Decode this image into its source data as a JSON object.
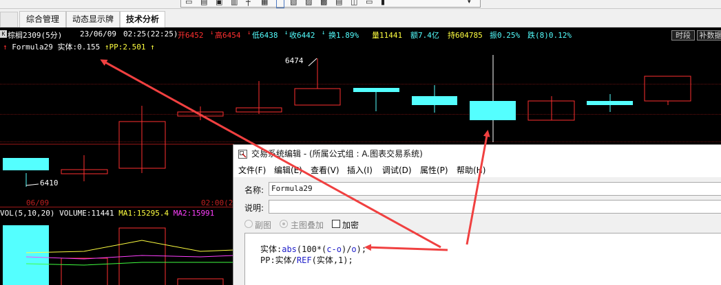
{
  "toolbar": {
    "icons": [
      "chart-icon",
      "drawing-icon",
      "layout-icon",
      "split-icon",
      "cursor-icon",
      "indicator-icon",
      "compare-icon",
      "period-icon",
      "window-icon",
      "grid-icon",
      "list-icon",
      "hand-icon",
      "pen-icon",
      "more-icon"
    ]
  },
  "tabs": [
    {
      "label": "综合管理"
    },
    {
      "label": "动态显示牌"
    },
    {
      "label": "技术分析"
    }
  ],
  "kbtn": "K",
  "quote": {
    "symbol": "棕榈2309(5分)",
    "date": "23/06/09",
    "time": "02:25(22:25)",
    "open_label": "开6452",
    "high_label": "高6454",
    "low_label": "低6438",
    "close_label": "收6442",
    "turnover_label": "换1.89%",
    "volume_label": "量11441",
    "amount_label": "额7.4亿",
    "oi_label": "持604785",
    "amplitude_label": "振0.25%",
    "change_label": "跌(8)0.12%",
    "btn_time": "时段",
    "btn_fill": "补数据"
  },
  "formula_line": {
    "name": "Formula29",
    "body_label": "实体:",
    "body_value": "0.155",
    "pp_label": "PP:",
    "pp_value": "2.501"
  },
  "price_marks": {
    "high": "6474",
    "low": "6410"
  },
  "dates": {
    "left": "06/09",
    "right": "02:00(2"
  },
  "vol_line": {
    "name": "VOL(5,10,20)",
    "volume": "VOLUME:11441",
    "ma1": "MA1:15295.4",
    "ma2": "MA2:15991"
  },
  "dialog": {
    "title": "交易系统编辑 - (所属公式组 : A.图表交易系统)",
    "menus": [
      "文件(F)",
      "编辑(E)",
      "查看(V)",
      "插入(I)",
      "调试(D)",
      "属性(P)",
      "帮助(H)"
    ],
    "name_label": "名称:",
    "name_value": "Formula29",
    "desc_label": "说明:",
    "desc_value": "",
    "opt_sub": "副图",
    "opt_main": "主图叠加",
    "opt_lock": "加密",
    "code": {
      "l1_a": "实体:",
      "l1_fn": "abs",
      "l1_b": "(100*(",
      "l1_c": "c-o",
      "l1_d": ")/",
      "l1_e": "o",
      "l1_f": ");",
      "l2_a": "PP:实体/",
      "l2_fn": "REF",
      "l2_b": "(实体,1);"
    }
  },
  "colors": {
    "up": "#ff3030",
    "down": "#54ffff",
    "arrow": "#f04040",
    "yellow": "#ffff40",
    "magenta": "#ff40ff",
    "white": "#ffffff"
  }
}
